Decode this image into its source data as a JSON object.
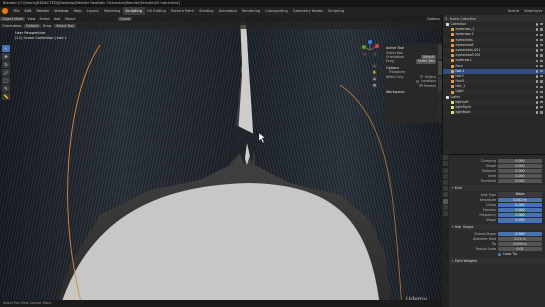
{
  "window": {
    "title": "Blender [C:\\Users\\[REDACTED]\\Desktop\\Blender Realistic Character\\Blender\\Female\\02 hair.blend]"
  },
  "menubar": {
    "menus": [
      "File",
      "Edit",
      "Render",
      "Window",
      "Help"
    ],
    "workspaces": [
      {
        "label": "Layout",
        "active": false
      },
      {
        "label": "Modeling",
        "active": false
      },
      {
        "label": "Sculpting",
        "active": true
      },
      {
        "label": "UV Editing",
        "active": false
      },
      {
        "label": "Texture Paint",
        "active": false
      },
      {
        "label": "Shading",
        "active": false
      },
      {
        "label": "Animation",
        "active": false
      },
      {
        "label": "Rendering",
        "active": false
      },
      {
        "label": "Compositing",
        "active": false
      },
      {
        "label": "Geometry Nodes",
        "active": false
      },
      {
        "label": "Scripting",
        "active": false
      }
    ],
    "scene_label": "Scene",
    "view_layer_label": "ViewLayer"
  },
  "viewport": {
    "header": {
      "mode": "Object Mode",
      "view": "View",
      "select": "Select",
      "add": "Add",
      "object": "Object",
      "orientation": "Global",
      "options": "Options"
    },
    "header2": {
      "orientation_label": "Orientation:",
      "orientation_value": "Default",
      "drag_label": "Drag:",
      "drag_value": "Select Box"
    },
    "info": {
      "line1": "User Perspective",
      "line2": "(11) Scene Collection | hair.1"
    },
    "tools": [
      "cursor",
      "move",
      "rotate",
      "scale",
      "transform",
      "annotate",
      "measure"
    ],
    "npanel": {
      "active_tool": "Active Tool",
      "select_box": "Select Box",
      "orientation_label": "Orientation",
      "orientation_value": "Default",
      "drag_label": "Drag",
      "drag_value": "Select Box",
      "options": "Options",
      "transform": "Transform",
      "affect_only": "Affect Only",
      "origins": "Origins",
      "locations": "Locations",
      "parents": "Parents",
      "workspace": "Workspace"
    },
    "watermark": "Udemy"
  },
  "outliner": {
    "header": {
      "filter": "Scene Collection"
    },
    "rows": [
      {
        "label": "Collection",
        "color": "#dcdcdc",
        "indent": 0,
        "selected": false
      },
      {
        "label": "eyebrows_1",
        "color": "#e8a040",
        "indent": 1,
        "selected": false
      },
      {
        "label": "eyebrows 2",
        "color": "#e8a040",
        "indent": 1,
        "selected": false
      },
      {
        "label": "eyelashesL",
        "color": "#e8a040",
        "indent": 1,
        "selected": false
      },
      {
        "label": "eyelashesR",
        "color": "#e8a040",
        "indent": 1,
        "selected": false
      },
      {
        "label": "eyelashesL.001",
        "color": "#e8a040",
        "indent": 1,
        "selected": false
      },
      {
        "label": "eyelashesR.001",
        "color": "#e8a040",
        "indent": 1,
        "selected": false
      },
      {
        "label": "eyebrow.L",
        "color": "#e8a040",
        "indent": 1,
        "selected": false
      },
      {
        "label": "Face",
        "color": "#e8a040",
        "indent": 1,
        "selected": false
      },
      {
        "label": "hair.1",
        "color": "#e8a040",
        "indent": 1,
        "selected": true
      },
      {
        "label": "hair2",
        "color": "#e8a040",
        "indent": 1,
        "selected": false
      },
      {
        "label": "Hair3",
        "color": "#e8a040",
        "indent": 1,
        "selected": false
      },
      {
        "label": "hair_1",
        "color": "#e8a040",
        "indent": 1,
        "selected": false
      },
      {
        "label": "Light",
        "color": "#e8a040",
        "indent": 1,
        "selected": false
      },
      {
        "label": "Lights",
        "color": "#dcdcdc",
        "indent": 0,
        "selected": false
      },
      {
        "label": "lightLeft",
        "color": "#e8e070",
        "indent": 1,
        "selected": false
      },
      {
        "label": "lightRight",
        "color": "#e8e070",
        "indent": 1,
        "selected": false
      },
      {
        "label": "lightBack",
        "color": "#e8e070",
        "indent": 1,
        "selected": false
      }
    ]
  },
  "properties": {
    "top_rows": [
      {
        "label": "Clumping",
        "value": "0.000"
      },
      {
        "label": "Shape",
        "value": "0.000"
      },
      {
        "label": "Distance",
        "value": "0.000"
      },
      {
        "label": "Seed",
        "value": "0.000"
      },
      {
        "label": "Threshold",
        "value": "0.000"
      }
    ],
    "kink_section": "Kink",
    "kink_rows": [
      {
        "label": "Kink Type",
        "value": "Wave",
        "style": "drop"
      },
      {
        "label": "Amplitude",
        "value": "0.012 m",
        "style": "blue"
      },
      {
        "label": "Clump",
        "value": "0.000",
        "style": "blue"
      },
      {
        "label": "Flatness",
        "value": "0.000",
        "style": "blue"
      },
      {
        "label": "Frequency",
        "value": "2.000",
        "style": "blue"
      },
      {
        "label": "Shape",
        "value": "0.000",
        "style": "blue"
      }
    ],
    "hair_shape_section": "Hair Shape",
    "hair_shape_rows": [
      {
        "label": "Strand Shape",
        "value": "0.000",
        "style": "blue"
      },
      {
        "label": "Diameter Root",
        "value": "0.01 m",
        "style": "plain"
      },
      {
        "label": "Tip",
        "value": "0.005 m",
        "style": "plain"
      },
      {
        "label": "Radius Scale",
        "value": "0.01",
        "style": "plain"
      }
    ],
    "close_tip_label": "Close Tip",
    "field_weights_section": "Field Weights"
  },
  "statusbar": {
    "text": "Select    Pan View    Context Menu"
  }
}
